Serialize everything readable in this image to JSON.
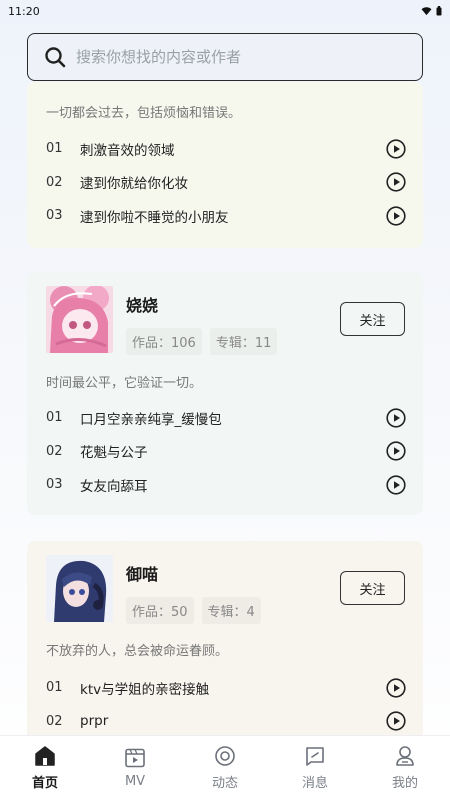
{
  "status": {
    "time": "11:20"
  },
  "search": {
    "placeholder": "搜索你想找的内容或作者"
  },
  "cards": [
    {
      "motto": "一切都会过去，包括烦恼和错误。",
      "songs": [
        {
          "num": "01",
          "title": "刺激音效的领域"
        },
        {
          "num": "02",
          "title": "逮到你就给你化妆"
        },
        {
          "num": "03",
          "title": "逮到你啦不睡觉的小朋友"
        }
      ]
    },
    {
      "name": "娆娆",
      "works": "作品：106",
      "albums": "专辑：11",
      "follow": "关注",
      "motto": "时间最公平，它验证一切。",
      "songs": [
        {
          "num": "01",
          "title": "口月空亲亲纯享_缓慢包"
        },
        {
          "num": "02",
          "title": "花魁与公子"
        },
        {
          "num": "03",
          "title": "女友向舔耳"
        }
      ]
    },
    {
      "name": "御喵",
      "works": "作品：50",
      "albums": "专辑：4",
      "follow": "关注",
      "motto": "不放弃的人，总会被命运眷顾。",
      "songs": [
        {
          "num": "01",
          "title": "ktv与学姐的亲密接触"
        },
        {
          "num": "02",
          "title": "prpr"
        }
      ]
    }
  ],
  "tabs": [
    {
      "label": "首页",
      "icon": "home-icon",
      "active": true
    },
    {
      "label": "MV",
      "icon": "video-icon",
      "active": false
    },
    {
      "label": "动态",
      "icon": "feed-icon",
      "active": false
    },
    {
      "label": "消息",
      "icon": "message-icon",
      "active": false
    },
    {
      "label": "我的",
      "icon": "profile-icon",
      "active": false
    }
  ]
}
